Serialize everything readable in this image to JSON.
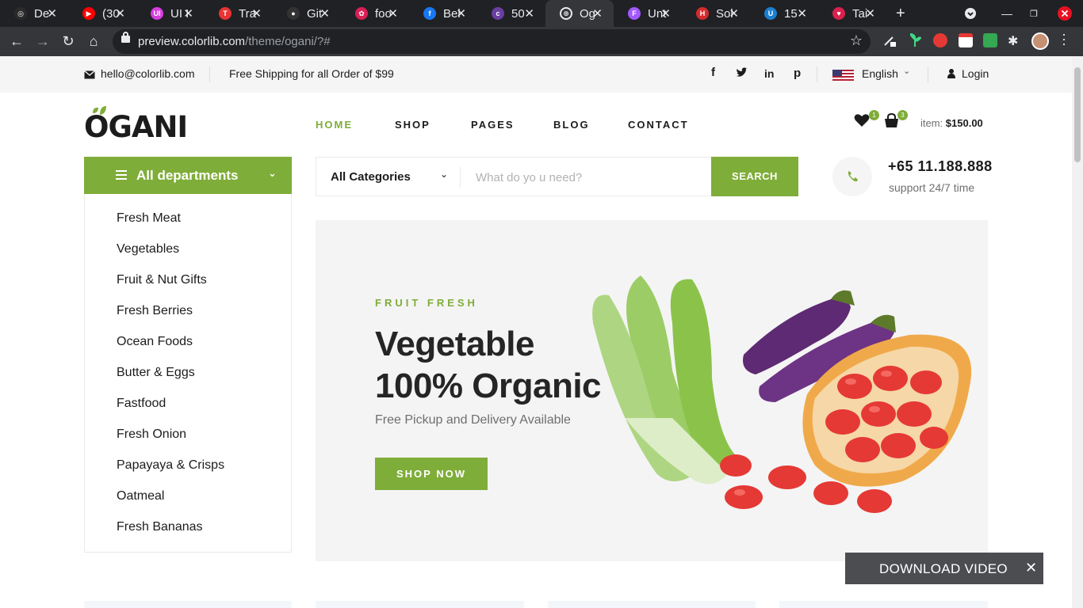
{
  "browser": {
    "tabs": [
      {
        "label": "De",
        "color": "#2b2b2b",
        "glyph": "◎"
      },
      {
        "label": "(30",
        "color": "#ff0000",
        "glyph": "▶"
      },
      {
        "label": "UI I",
        "color": "#d83de0",
        "glyph": "UI"
      },
      {
        "label": "Tra",
        "color": "#e83434",
        "glyph": "T"
      },
      {
        "label": "Git",
        "color": "#333333",
        "glyph": "●"
      },
      {
        "label": "foo",
        "color": "#d81f55",
        "glyph": "✿"
      },
      {
        "label": "Bel",
        "color": "#1877f2",
        "glyph": "f"
      },
      {
        "label": "50",
        "color": "#6a3fa0",
        "glyph": "c"
      },
      {
        "label": "Og",
        "color": "#e8eaed",
        "glyph": "⊕",
        "active": true
      },
      {
        "label": "Unt",
        "color": "#a259ff",
        "glyph": "F"
      },
      {
        "label": "Sol",
        "color": "#d42c2c",
        "glyph": "H"
      },
      {
        "label": "15",
        "color": "#1a7fcf",
        "glyph": "U"
      },
      {
        "label": "Tai",
        "color": "#d9214e",
        "glyph": "♥"
      }
    ],
    "url_host": "preview.colorlib.com",
    "url_path": "/theme/ogani/?#"
  },
  "topbar": {
    "email": "hello@colorlib.com",
    "shipping": "Free Shipping for all Order of $99",
    "language": "English",
    "login": "Login"
  },
  "header": {
    "logo": "OGANI",
    "nav": [
      "HOME",
      "SHOP",
      "PAGES",
      "BLOG",
      "CONTACT"
    ],
    "wishlist_count": "1",
    "cart_count": "3",
    "cart_label": "item:",
    "cart_total": "$150.00"
  },
  "departments": {
    "title": "All departments",
    "items": [
      "Fresh Meat",
      "Vegetables",
      "Fruit & Nut Gifts",
      "Fresh Berries",
      "Ocean Foods",
      "Butter & Eggs",
      "Fastfood",
      "Fresh Onion",
      "Papayaya & Crisps",
      "Oatmeal",
      "Fresh Bananas"
    ]
  },
  "search": {
    "category": "All Categories",
    "placeholder": "What do yo u need?",
    "button": "SEARCH"
  },
  "contact": {
    "phone": "+65 11.188.888",
    "support": "support 24/7 time"
  },
  "hero": {
    "kicker": "FRUIT FRESH",
    "line1": "Vegetable",
    "line2": "100% Organic",
    "sub": "Free Pickup and Delivery Available",
    "cta": "SHOP NOW"
  },
  "download": {
    "label": "DOWNLOAD VIDEO"
  },
  "colors": {
    "brand_green": "#7fad39",
    "text_dark": "#1c1c1c",
    "chrome_dark": "#202124"
  }
}
